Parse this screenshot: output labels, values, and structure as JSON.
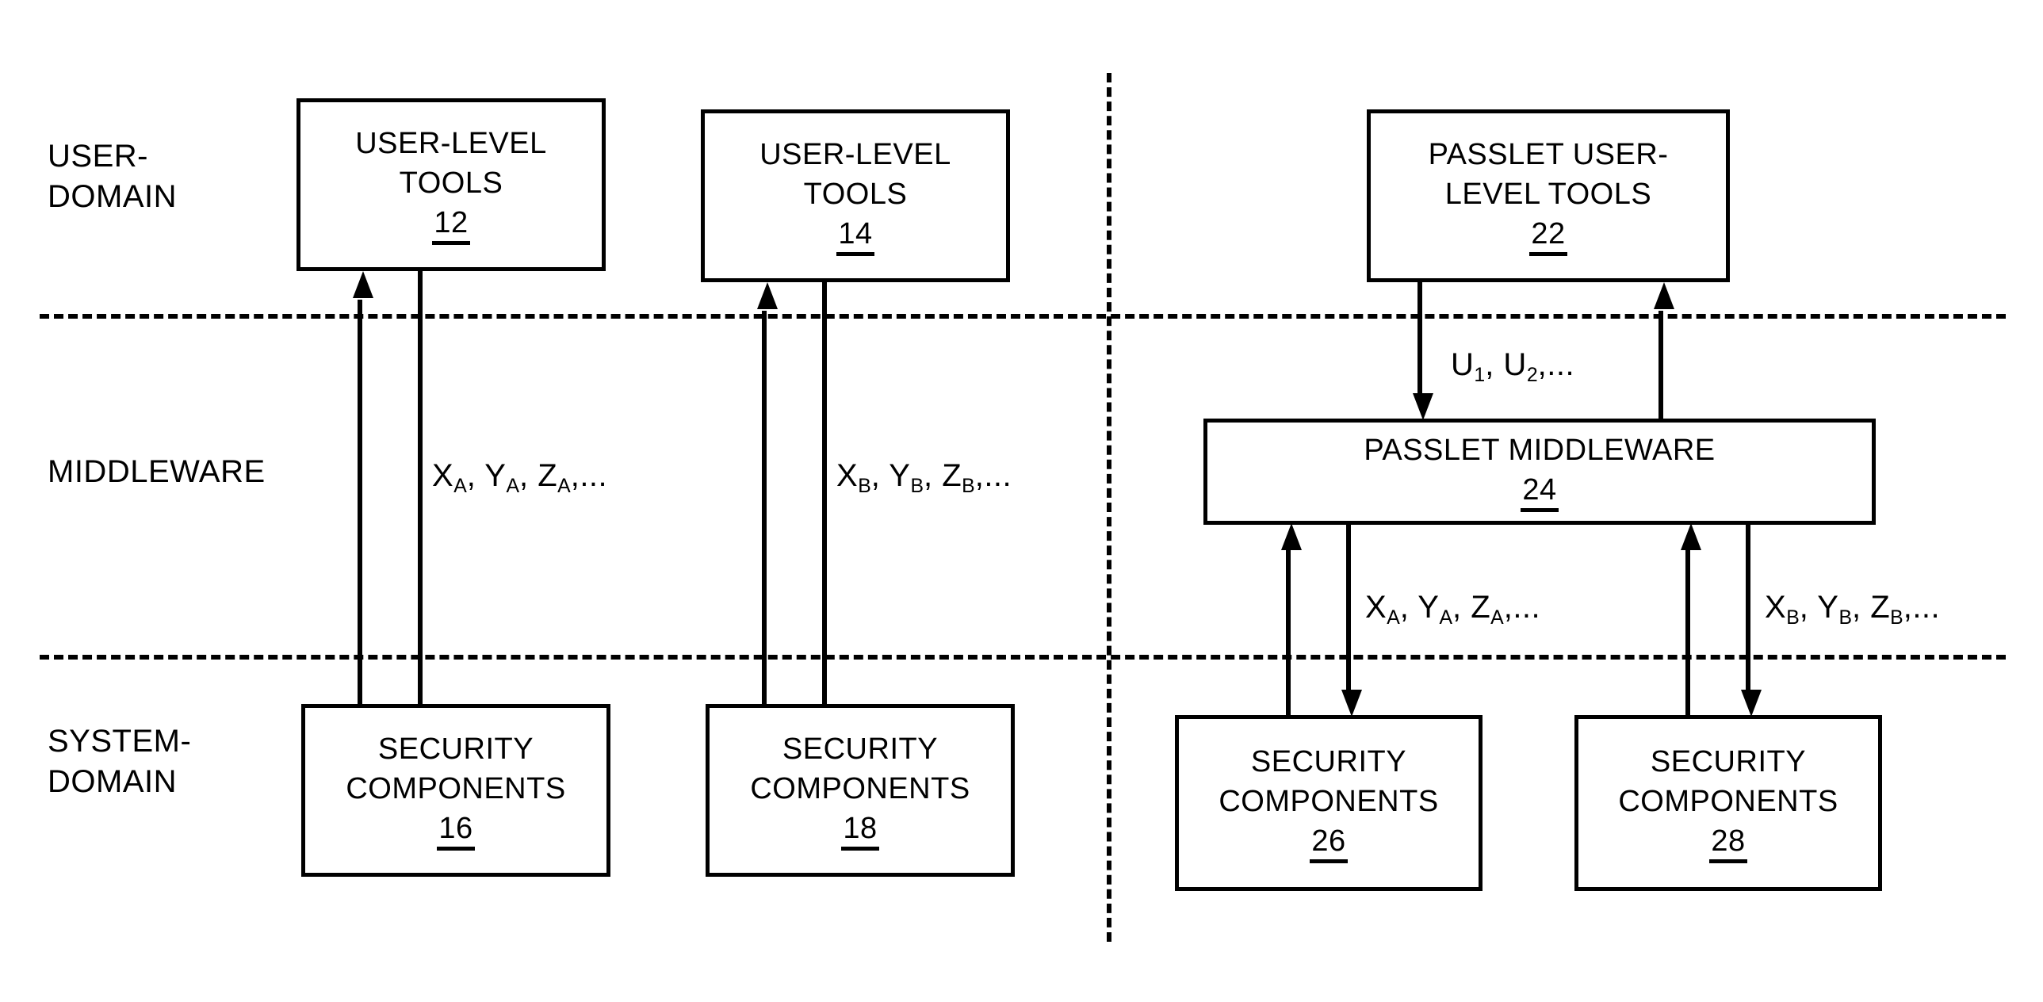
{
  "figure": {
    "title": "Security architecture block diagram",
    "background_color": "#ffffff",
    "line_color": "#000000"
  },
  "row_labels": [
    {
      "id": "user-domain",
      "text": "USER-\nDOMAIN"
    },
    {
      "id": "middleware",
      "text": "MIDDLEWARE"
    },
    {
      "id": "system-domain",
      "text": "SYSTEM-\nDOMAIN"
    }
  ],
  "boxes": [
    {
      "id": "user-level-tools-12",
      "title": "USER-LEVEL\nTOOLS",
      "number": "12"
    },
    {
      "id": "user-level-tools-14",
      "title": "USER-LEVEL\nTOOLS",
      "number": "14"
    },
    {
      "id": "passlet-user-tools-22",
      "title": "PASSLET USER-\nLEVEL TOOLS",
      "number": "22"
    },
    {
      "id": "passlet-middleware-24",
      "title": "PASSLET MIDDLEWARE",
      "number": "24"
    },
    {
      "id": "security-components-16",
      "title": "SECURITY\nCOMPONENTS",
      "number": "16"
    },
    {
      "id": "security-components-18",
      "title": "SECURITY\nCOMPONENTS",
      "number": "18"
    },
    {
      "id": "security-components-26",
      "title": "SECURITY\nCOMPONENTS",
      "number": "26"
    },
    {
      "id": "security-components-28",
      "title": "SECURITY\nCOMPONENTS",
      "number": "28"
    }
  ],
  "signals": [
    {
      "id": "signal-xa-left",
      "symbols": [
        "X",
        "Y",
        "Z"
      ],
      "subscript": "A",
      "ellipsis": ",..."
    },
    {
      "id": "signal-xb-left",
      "symbols": [
        "X",
        "Y",
        "Z"
      ],
      "subscript": "B",
      "ellipsis": ",..."
    },
    {
      "id": "signal-u",
      "symbols": [
        "U",
        "U"
      ],
      "subscript": "",
      "ellipsis": ",..."
    },
    {
      "id": "signal-xa-right",
      "symbols": [
        "X",
        "Y",
        "Z"
      ],
      "subscript": "A",
      "ellipsis": ",..."
    },
    {
      "id": "signal-xb-right",
      "symbols": [
        "X",
        "Y",
        "Z"
      ],
      "subscript": "B",
      "ellipsis": ",..."
    }
  ],
  "signal_text": {
    "xa": "Xₐ, Yₐ, Zₐ,...",
    "xb": "Xʙ, Yʙ, Zʙ,...",
    "u": "U₁, U₂,..."
  },
  "signal_parts": {
    "x": "X",
    "y": "Y",
    "z": "Z",
    "u": "U",
    "sub_a": "A",
    "sub_b": "B",
    "sub_1": "1",
    "sub_2": "2",
    "comma": ", ",
    "tail": ",..."
  }
}
